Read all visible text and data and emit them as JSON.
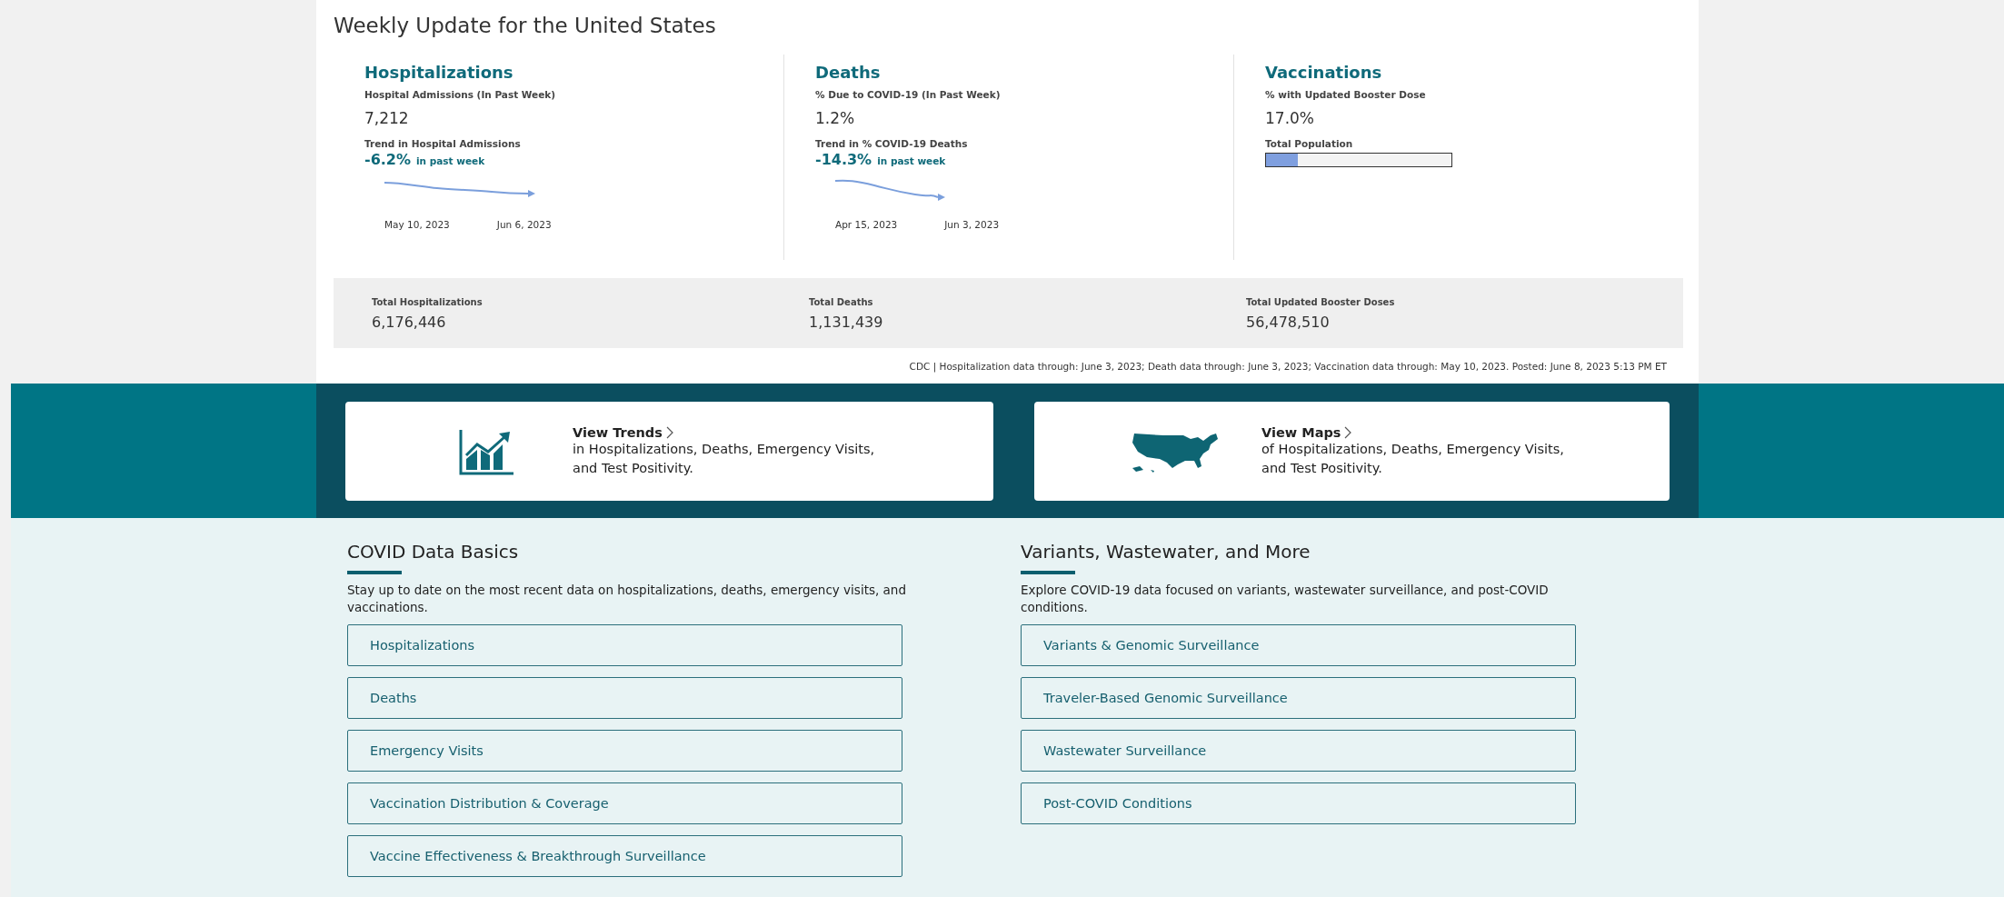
{
  "title": "Weekly Update for the United States",
  "metrics": [
    {
      "kind": "trend",
      "heading": "Hospitalizations",
      "label": "Hospital Admissions (In Past Week)",
      "value": "7,212",
      "trend_label": "Trend in Hospital Admissions",
      "trend_value": "-6.2%",
      "trend_suffix": "in past week",
      "dates": [
        "May 10, 2023",
        "Jun 6, 2023"
      ]
    },
    {
      "kind": "trend",
      "heading": "Deaths",
      "label": "% Due to COVID-19 (In Past Week)",
      "value": "1.2%",
      "trend_label": "Trend in % COVID-19 Deaths",
      "trend_value": "-14.3%",
      "trend_suffix": "in past week",
      "dates": [
        "Apr 15, 2023",
        "Jun 3, 2023"
      ]
    },
    {
      "kind": "progress",
      "heading": "Vaccinations",
      "label": "% with Updated Booster Dose",
      "value": "17.0%",
      "bar_label": "Total Population",
      "level": 0.17
    }
  ],
  "totals": [
    {
      "label": "Total Hospitalizations",
      "value": "6,176,446"
    },
    {
      "label": "Total Deaths",
      "value": "1,131,439"
    },
    {
      "label": "Total Updated Booster Doses",
      "value": "56,478,510"
    }
  ],
  "source_note": "CDC | Hospitalization data through: June 3, 2023; Death data through: June 3, 2023; Vaccination data through: May 10, 2023. Posted: June 8, 2023 5:13 PM ET",
  "feature_links": [
    {
      "kind": "trends",
      "title": "View Trends",
      "description": "in Hospitalizations, Deaths, Emergency Visits, and Test Positivity."
    },
    {
      "kind": "maps",
      "title": "View Maps",
      "description": "of Hospitalizations, Deaths, Emergency Visits, and Test Positivity."
    }
  ],
  "sections": [
    {
      "heading": "COVID Data Basics",
      "description": "Stay up to date on the most recent data on hospitalizations, deaths, emergency visits, and vaccinations.",
      "links": [
        "Hospitalizations",
        "Deaths",
        "Emergency Visits",
        "Vaccination Distribution & Coverage",
        "Vaccine Effectiveness & Breakthrough Surveillance"
      ]
    },
    {
      "heading": "Variants, Wastewater, and More",
      "description": "Explore COVID-19 data focused on variants, wastewater surveillance, and post-COVID conditions.",
      "links": [
        "Variants & Genomic Surveillance",
        "Traveler-Based Genomic Surveillance",
        "Wastewater Surveillance",
        "Post-COVID Conditions"
      ]
    }
  ]
}
